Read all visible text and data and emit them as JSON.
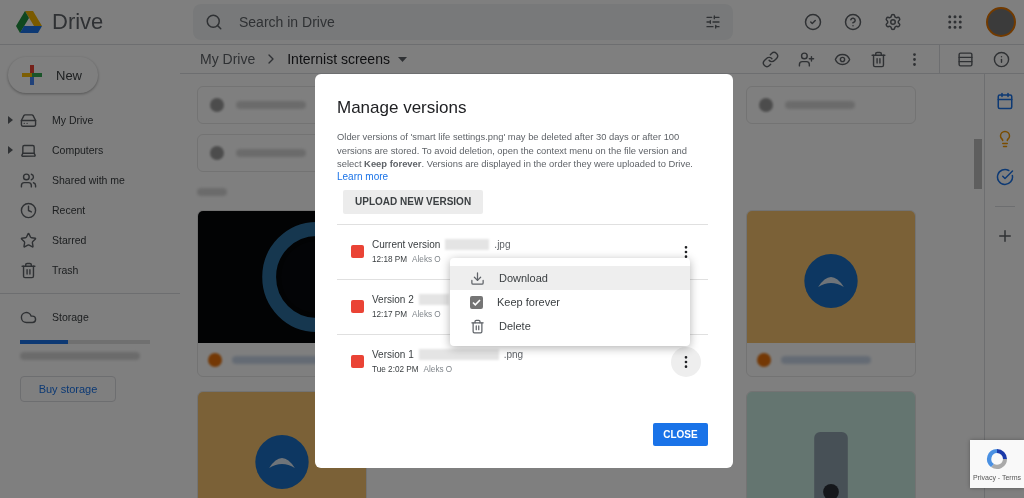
{
  "header": {
    "app_name": "Drive",
    "search": {
      "placeholder": "Search in Drive"
    }
  },
  "new_button": "New",
  "sidebar": {
    "items": [
      {
        "label": "My Drive",
        "expandable": true
      },
      {
        "label": "Computers",
        "expandable": true
      },
      {
        "label": "Shared with me",
        "expandable": false
      },
      {
        "label": "Recent",
        "expandable": false
      },
      {
        "label": "Starred",
        "expandable": false
      },
      {
        "label": "Trash",
        "expandable": false
      }
    ],
    "storage": {
      "label": "Storage",
      "level": 0.37
    },
    "buy_button": "Buy storage"
  },
  "breadcrumb": [
    "My Drive",
    "Internist screens"
  ],
  "dialog": {
    "title": "Manage versions",
    "description": "Older versions of 'smart life settings.png' may be deleted after 30 days or after 100 versions are stored. To avoid deletion, open the context menu on the file version and select **Keep forever**. Versions are displayed in the order they were uploaded to Drive.",
    "learn_more": "Learn more",
    "upload_button": "UPLOAD NEW VERSION",
    "versions": [
      {
        "label": "Current version",
        "extension": ".jpg",
        "time": "12:18 PM",
        "author": "Aleks O",
        "hovered": false
      },
      {
        "label": "Version 2",
        "time": "12:17 PM",
        "author": "Aleks O"
      },
      {
        "label": "Version 1",
        "extension": ".png",
        "time": "Tue 2:02 PM",
        "author": "Aleks O",
        "hovered": true
      }
    ],
    "close_button": "CLOSE"
  },
  "context_menu": {
    "items": [
      {
        "label": "Download",
        "kind": "download",
        "selected": true
      },
      {
        "label": "Keep forever",
        "kind": "checkbox",
        "selected": false,
        "checked": true
      },
      {
        "label": "Delete",
        "kind": "delete",
        "selected": false
      }
    ]
  },
  "recaptcha": {
    "links": "Privacy - Terms"
  }
}
